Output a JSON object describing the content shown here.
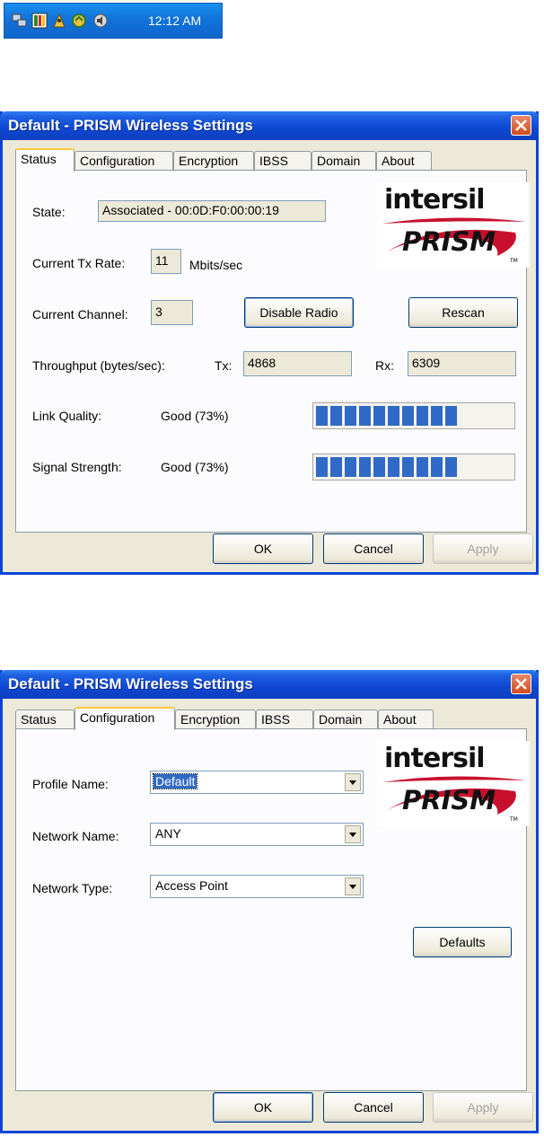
{
  "tray": {
    "time": "12:12 AM",
    "icons": [
      "network-icon",
      "monitor-icon",
      "wireless-icon",
      "update-icon",
      "volume-icon"
    ]
  },
  "logo": {
    "brand_top": "intersil",
    "brand_bottom": "PRISM",
    "tm": "TM"
  },
  "window1": {
    "title": "Default - PRISM Wireless Settings",
    "tabs": [
      "Status",
      "Configuration",
      "Encryption",
      "IBSS",
      "Domain",
      "About"
    ],
    "active_tab": "Status",
    "state_label": "State:",
    "state_value": "Associated - 00:0D:F0:00:00:19",
    "tx_rate_label": "Current Tx Rate:",
    "tx_rate_value": "11",
    "tx_rate_unit": "Mbits/sec",
    "channel_label": "Current Channel:",
    "channel_value": "3",
    "disable_radio": "Disable Radio",
    "rescan": "Rescan",
    "throughput_label": "Throughput (bytes/sec):",
    "tx_label": "Tx:",
    "tx_value": "4868",
    "rx_label": "Rx:",
    "rx_value": "6309",
    "link_quality_label": "Link Quality:",
    "link_quality_value": "Good (73%)",
    "link_quality_level": 0.73,
    "signal_label": "Signal Strength:",
    "signal_value": "Good (73%)",
    "signal_level": 0.73,
    "ok": "OK",
    "cancel": "Cancel",
    "apply": "Apply"
  },
  "window2": {
    "title": "Default - PRISM Wireless Settings",
    "tabs": [
      "Status",
      "Configuration",
      "Encryption",
      "IBSS",
      "Domain",
      "About"
    ],
    "active_tab": "Configuration",
    "profile_label": "Profile Name:",
    "profile_value": "Default",
    "network_name_label": "Network Name:",
    "network_name_value": "ANY",
    "network_type_label": "Network Type:",
    "network_type_value": "Access Point",
    "defaults": "Defaults",
    "ok": "OK",
    "cancel": "Cancel",
    "apply": "Apply"
  },
  "colors": {
    "title_blue": "#0c3fbe",
    "progress_blue": "#3169c6",
    "dialog_bg": "#ece9d8",
    "close_red": "#d4491b"
  }
}
